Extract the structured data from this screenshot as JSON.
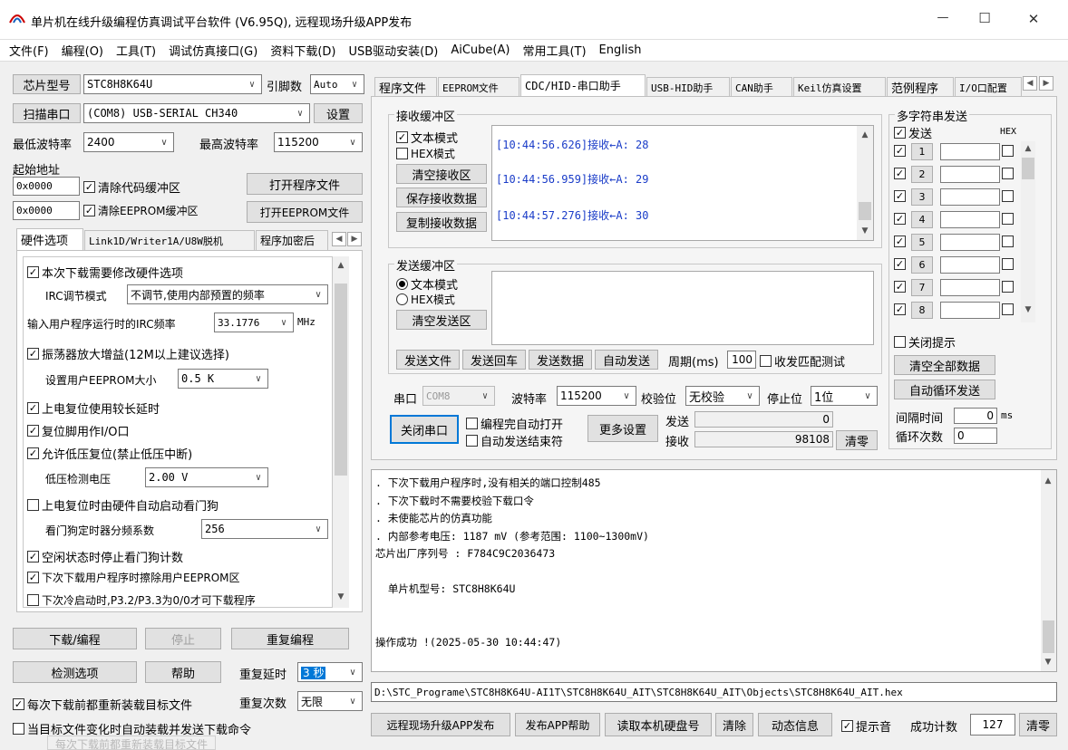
{
  "window": {
    "title": "单片机在线升级编程仿真调试平台软件 (V6.95Q), 远程现场升级APP发布",
    "min": "—",
    "max": "☐",
    "close": "✕"
  },
  "menu": [
    "文件(F)",
    "编程(O)",
    "工具(T)",
    "调试仿真接口(G)",
    "资料下载(D)",
    "USB驱动安装(D)",
    "AiCube(A)",
    "常用工具(T)",
    "English"
  ],
  "left": {
    "chip_btn": "芯片型号",
    "chip_val": "STC8H8K64U",
    "pin_label": "引脚数",
    "pin_val": "Auto",
    "scan_btn": "扫描串口",
    "port_val": "(COM8) USB-SERIAL CH340",
    "settings_btn": "设置",
    "min_baud_label": "最低波特率",
    "min_baud_val": "2400",
    "max_baud_label": "最高波特率",
    "max_baud_val": "115200",
    "start_addr_label": "起始地址",
    "addr1": "0x0000",
    "clear_code": "清除代码缓冲区",
    "open_prog": "打开程序文件",
    "addr2": "0x0000",
    "clear_eeprom": "清除EEPROM缓冲区",
    "open_eeprom": "打开EEPROM文件",
    "tabs": [
      "硬件选项",
      "Link1D/Writer1A/U8W脱机",
      "程序加密后"
    ],
    "options": {
      "o1": "本次下载需要修改硬件选项",
      "irc_mode_label": "IRC调节模式",
      "irc_mode_val": "不调节,使用内部预置的频率",
      "irc_freq_label": "输入用户程序运行时的IRC频率",
      "irc_freq_val": "33.1776",
      "irc_unit": "MHz",
      "o2": "振荡器放大增益(12M以上建议选择)",
      "eeprom_size_label": "设置用户EEPROM大小",
      "eeprom_size_val": "0.5 K",
      "o3": "上电复位使用较长延时",
      "o4": "复位脚用作I/O口",
      "o5": "允许低压复位(禁止低压中断)",
      "lv_label": "低压检测电压",
      "lv_val": "2.00 V",
      "o6": "上电复位时由硬件自动启动看门狗",
      "wdt_label": "看门狗定时器分频系数",
      "wdt_val": "256",
      "o7": "空闲状态时停止看门狗计数",
      "o8": "下次下载用户程序时擦除用户EEPROM区",
      "o9": "下次冷启动时,P3.2/P3.3为0/0才可下载程序"
    },
    "download_btn": "下载/编程",
    "stop_btn": "停止",
    "reprog_btn": "重复编程",
    "detect_btn": "检测选项",
    "help_btn": "帮助",
    "repeat_delay_label": "重复延时",
    "repeat_delay_val": "3 秒",
    "reload_label": "每次下载前都重新装载目标文件",
    "repeat_count_label": "重复次数",
    "repeat_count_val": "无限",
    "auto_reload_label": "当目标文件变化时自动装载并发送下载命令",
    "ghost": "每次下载前都重新装载目标文件"
  },
  "right": {
    "tabs": [
      "程序文件",
      "EEPROM文件",
      "CDC/HID-串口助手",
      "USB-HID助手",
      "CAN助手",
      "Keil仿真设置",
      "范例程序",
      "I/O口配置"
    ],
    "recv_group": "接收缓冲区",
    "text_mode": "文本模式",
    "hex_mode": "HEX模式",
    "clear_recv": "清空接收区",
    "save_recv": "保存接收数据",
    "copy_recv": "复制接收数据",
    "recv_lines": [
      "[10:44:56.626]接收←A: 28",
      "[10:44:56.959]接收←A: 29",
      "[10:44:57.276]接收←A: 30"
    ],
    "send_group": "发送缓冲区",
    "send_text_mode": "文本模式",
    "send_hex_mode": "HEX模式",
    "clear_send": "清空发送区",
    "send_file": "发送文件",
    "send_cr": "发送回车",
    "send_data": "发送数据",
    "auto_send": "自动发送",
    "period_label": "周期(ms)",
    "period_val": "100",
    "match_test": "收发匹配测试",
    "port_label": "串口",
    "port_val": "COM8",
    "baud_label": "波特率",
    "baud_val": "115200",
    "parity_label": "校验位",
    "parity_val": "无校验",
    "stop_label": "停止位",
    "stop_val": "1位",
    "close_port": "关闭串口",
    "auto_open": "编程完自动打开",
    "auto_send_end": "自动发送结束符",
    "more_settings": "更多设置",
    "sent_label": "发送",
    "sent_val": "0",
    "recvd_label": "接收",
    "recvd_val": "98108",
    "clear_counts": "清零",
    "multi_group": "多字符串发送",
    "multi_send": "发送",
    "multi_hex": "HEX",
    "multi_rows": [
      "1",
      "2",
      "3",
      "4",
      "5",
      "6",
      "7",
      "8"
    ],
    "close_tip": "关闭提示",
    "clear_all": "清空全部数据",
    "auto_loop": "自动循环发送",
    "interval_label": "间隔时间",
    "interval_val": "0",
    "interval_unit": "ms",
    "loop_label": "循环次数",
    "loop_val": "0"
  },
  "log": {
    "lines": [
      ". 下次下载用户程序时,没有相关的端口控制485",
      ". 下次下载时不需要校验下载口令",
      ". 未使能芯片的仿真功能",
      ". 内部参考电压: 1187 mV (参考范围: 1100~1300mV)",
      "芯片出厂序列号 : F784C9C2036473",
      "",
      "  单片机型号: STC8H8K64U",
      "",
      "",
      "操作成功 !(2025-05-30 10:44:47)"
    ]
  },
  "path": "D:\\STC_Programe\\STC8H8K64U-AI1T\\STC8H8K64U_AIT\\STC8H8K64U_AIT\\Objects\\STC8H8K64U_AIT.hex",
  "bottom": {
    "remote_app": "远程现场升级APP发布",
    "publish_help": "发布APP帮助",
    "read_disk": "读取本机硬盘号",
    "clear": "清除",
    "dynamic_info": "动态信息",
    "beep": "提示音",
    "success_label": "成功计数",
    "success_val": "127",
    "clear_zero": "清零"
  }
}
